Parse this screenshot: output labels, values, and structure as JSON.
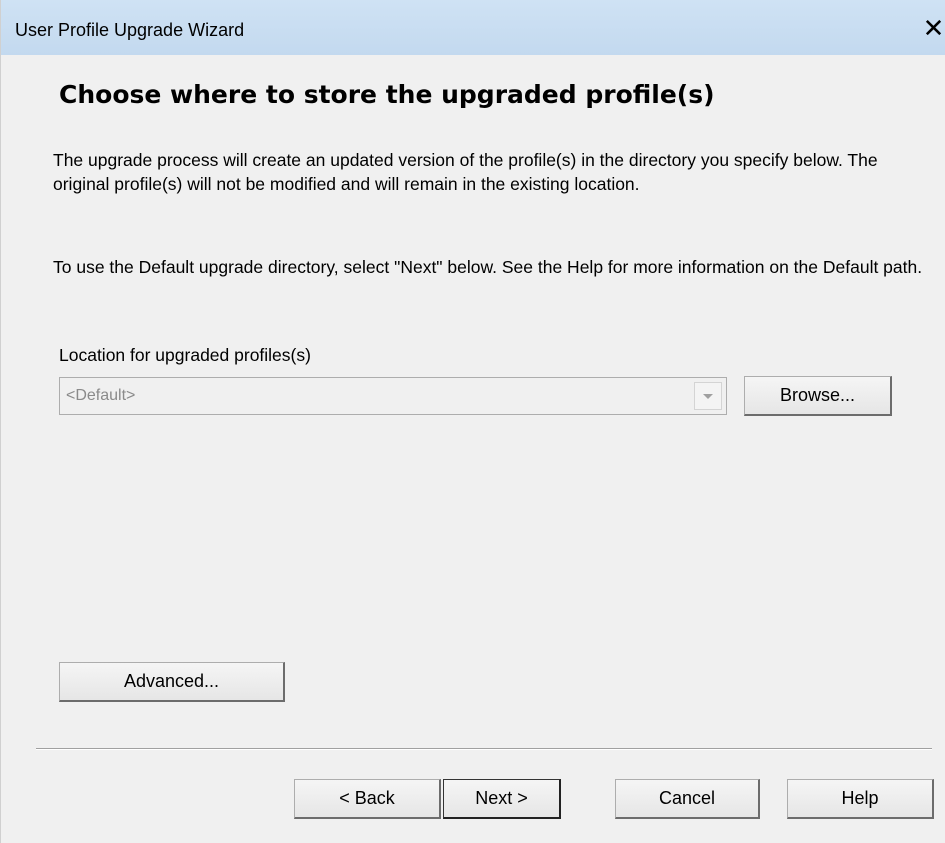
{
  "window": {
    "title": "User Profile Upgrade Wizard",
    "close_glyph": "✕"
  },
  "page": {
    "heading": "Choose where to store the upgraded profile(s)",
    "para1": "The upgrade process will create an updated version of the profile(s) in the directory you specify below. The original profile(s) will not be modified and will remain in the existing location.",
    "para2": "To use the Default upgrade directory, select \"Next\" below. See the Help for more information on the Default path."
  },
  "location": {
    "label": "Location for upgraded profiles(s)",
    "value": "<Default>",
    "enabled": false,
    "browse_label": "Browse..."
  },
  "advanced_label": "Advanced...",
  "footer": {
    "back_label": "< Back",
    "next_label": "Next >",
    "cancel_label": "Cancel",
    "help_label": "Help"
  },
  "colors": {
    "titlebar": "#c3d9ef",
    "window_bg": "#f0f0f0",
    "disabled_text": "#8a8a8a"
  }
}
